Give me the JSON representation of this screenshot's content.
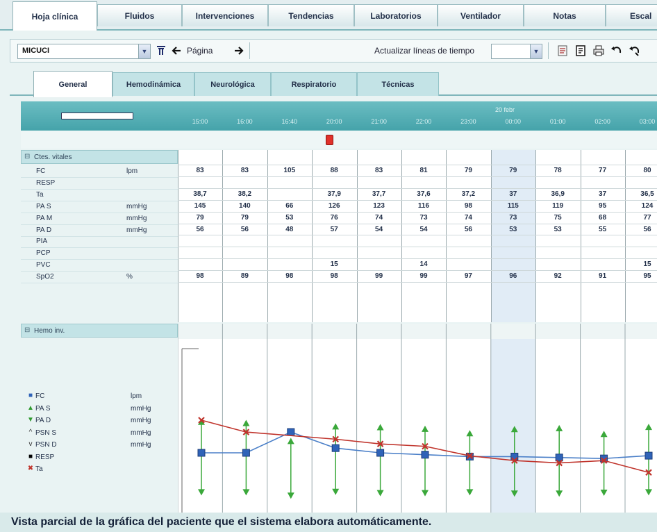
{
  "top_tabs": [
    "Hoja clínica",
    "Fluidos",
    "Intervenciones",
    "Tendencias",
    "Laboratorios",
    "Ventilador",
    "Notas",
    "Escal"
  ],
  "toolbar": {
    "unit_value": "MICUCI",
    "page_label": "Página",
    "refresh_label": "Actualizar líneas de tiempo",
    "icons": [
      "filter-icon",
      "arrow-left-icon",
      "arrow-right-icon",
      "document-icon",
      "notes-icon",
      "print-icon",
      "undo-icon",
      "undo-all-icon"
    ]
  },
  "sub_tabs": [
    "General",
    "Hemodinámica",
    "Neurológica",
    "Respiratorio",
    "Técnicas"
  ],
  "timeline": {
    "date_label": "20 febr",
    "times": [
      "15:00",
      "16:00",
      "16:40",
      "20:00",
      "21:00",
      "22:00",
      "23:00",
      "00:00",
      "01:00",
      "02:00",
      "03:00"
    ]
  },
  "vitals": {
    "section": "Ctes. vitales",
    "rows": [
      {
        "name": "FC",
        "unit": "lpm",
        "values": [
          "83",
          "83",
          "105",
          "88",
          "83",
          "81",
          "79",
          "79",
          "78",
          "77",
          "80"
        ]
      },
      {
        "name": "RESP",
        "unit": "",
        "values": [
          "",
          "",
          "",
          "",
          "",
          "",
          "",
          "",
          "",
          "",
          ""
        ]
      },
      {
        "name": "Ta",
        "unit": "",
        "values": [
          "38,7",
          "38,2",
          "",
          "37,9",
          "37,7",
          "37,6",
          "37,2",
          "37",
          "36,9",
          "37",
          "36,5"
        ]
      },
      {
        "name": "PA S",
        "unit": "mmHg",
        "values": [
          "145",
          "140",
          "66",
          "126",
          "123",
          "116",
          "98",
          "115",
          "119",
          "95",
          "124"
        ]
      },
      {
        "name": "PA M",
        "unit": "mmHg",
        "values": [
          "79",
          "79",
          "53",
          "76",
          "74",
          "73",
          "74",
          "73",
          "75",
          "68",
          "77"
        ]
      },
      {
        "name": "PA D",
        "unit": "mmHg",
        "values": [
          "56",
          "56",
          "48",
          "57",
          "54",
          "54",
          "56",
          "53",
          "53",
          "55",
          "56"
        ]
      },
      {
        "name": "PIA",
        "unit": "",
        "values": [
          "",
          "",
          "",
          "",
          "",
          "",
          "",
          "",
          "",
          "",
          ""
        ]
      },
      {
        "name": "PCP",
        "unit": "",
        "values": [
          "",
          "",
          "",
          "",
          "",
          "",
          "",
          "",
          "",
          "",
          ""
        ]
      },
      {
        "name": "PVC",
        "unit": "",
        "values": [
          "",
          "",
          "",
          "15",
          "",
          "14",
          "",
          "",
          "",
          "",
          "15"
        ]
      },
      {
        "name": "SpO2",
        "unit": "%",
        "values": [
          "98",
          "89",
          "98",
          "98",
          "99",
          "99",
          "97",
          "96",
          "92",
          "91",
          "95"
        ]
      }
    ]
  },
  "hemo": {
    "section": "Hemo inv.",
    "legend": [
      {
        "symbol": "■",
        "name": "FC",
        "unit": "lpm",
        "color": "#2f63b8"
      },
      {
        "symbol": "▲",
        "name": "PA S",
        "unit": "mmHg",
        "color": "#2f9a2f"
      },
      {
        "symbol": "▼",
        "name": "PA D",
        "unit": "mmHg",
        "color": "#2f9a2f"
      },
      {
        "symbol": "^",
        "name": "PSN S",
        "unit": "mmHg",
        "color": "#333333"
      },
      {
        "symbol": "v",
        "name": "PSN D",
        "unit": "mmHg",
        "color": "#333333"
      },
      {
        "symbol": "■",
        "name": "RESP",
        "unit": "",
        "color": "#000000"
      },
      {
        "symbol": "✖",
        "name": "Ta",
        "unit": "",
        "color": "#c0342c"
      }
    ]
  },
  "chart_data": {
    "type": "line",
    "x": [
      "15:00",
      "16:00",
      "16:40",
      "20:00",
      "21:00",
      "22:00",
      "23:00",
      "00:00",
      "01:00",
      "02:00",
      "03:00"
    ],
    "series": [
      {
        "name": "FC",
        "values": [
          83,
          83,
          105,
          88,
          83,
          81,
          79,
          79,
          78,
          77,
          80
        ],
        "color": "#4a7fc8"
      },
      {
        "name": "Ta",
        "values": [
          38.7,
          38.2,
          null,
          37.9,
          37.7,
          37.6,
          37.2,
          37,
          36.9,
          37,
          36.5
        ],
        "color": "#c0342c"
      },
      {
        "name": "PA S",
        "values": [
          145,
          140,
          66,
          126,
          123,
          116,
          98,
          115,
          119,
          95,
          124
        ],
        "color": "#3aa83a"
      },
      {
        "name": "PA D",
        "values": [
          56,
          56,
          48,
          57,
          54,
          54,
          56,
          53,
          53,
          55,
          56
        ],
        "color": "#3aa83a"
      }
    ]
  },
  "caption": "Vista parcial de la gráfica del paciente que el sistema elabora automáticamente."
}
